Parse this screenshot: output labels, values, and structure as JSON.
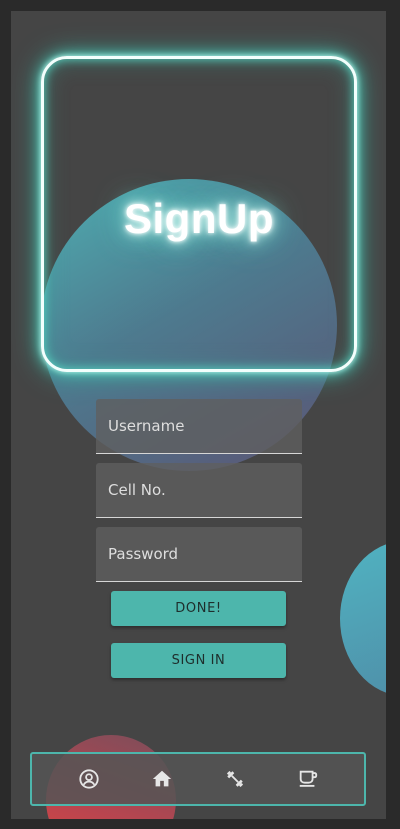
{
  "header": {
    "title": "SignUp"
  },
  "form": {
    "username_placeholder": "Username",
    "cell_placeholder": "Cell No.",
    "password_placeholder": "Password",
    "done_label": "DONE!",
    "signin_label": "SIGN IN"
  },
  "bottom_nav": {
    "items": [
      {
        "icon": "account-circle-icon"
      },
      {
        "icon": "home-icon"
      },
      {
        "icon": "fitness-icon"
      },
      {
        "icon": "coffee-icon"
      }
    ]
  },
  "colors": {
    "accent": "#4db6ac",
    "background": "#454545",
    "neon": "#59d9c6"
  }
}
